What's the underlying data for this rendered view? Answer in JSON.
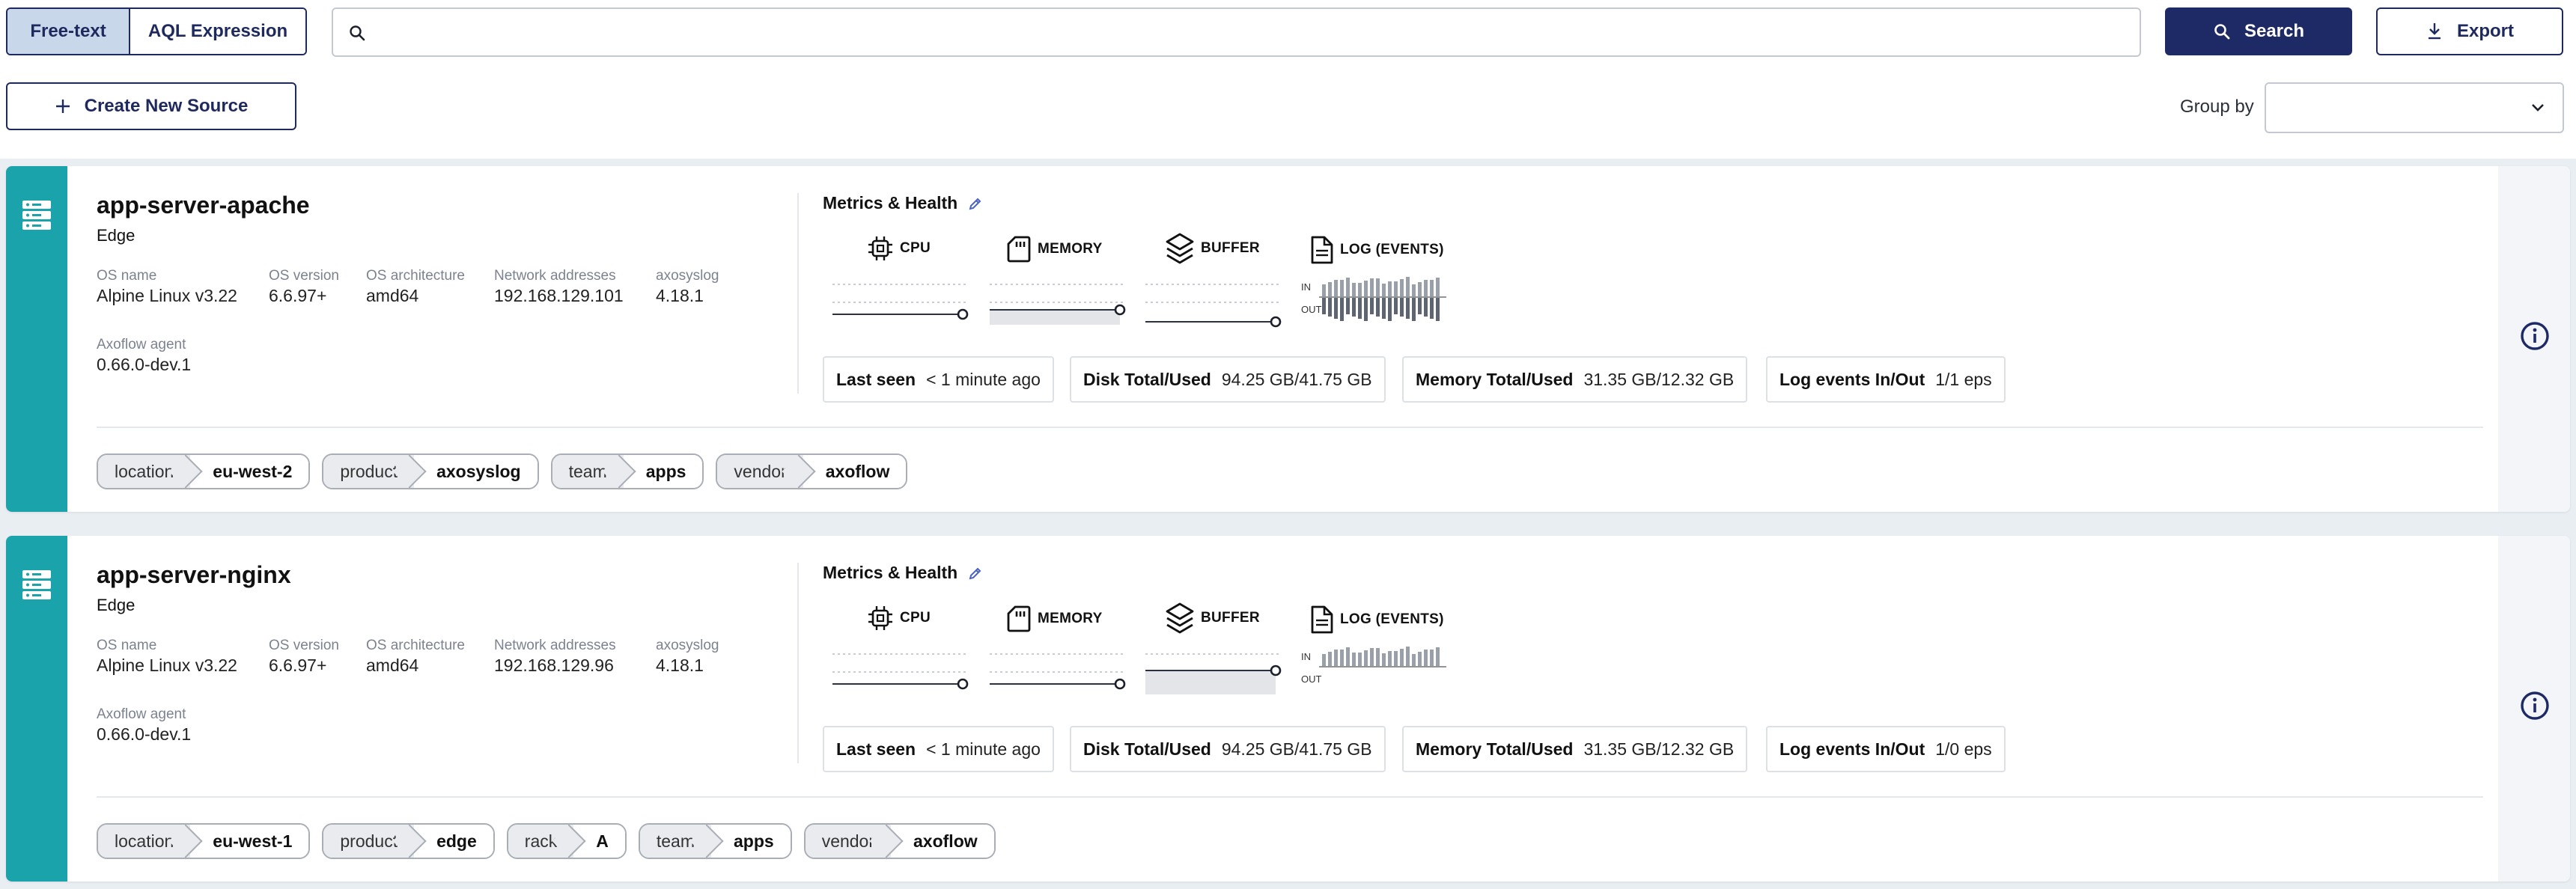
{
  "toolbar": {
    "mode_freetext": "Free-text",
    "mode_aql": "AQL Expression",
    "search_placeholder": "",
    "search_label": "Search",
    "export_label": "Export",
    "create_label": "Create New Source",
    "groupby_label": "Group by",
    "groupby_value": ""
  },
  "metrics_labels": {
    "title": "Metrics & Health",
    "cpu": "CPU",
    "memory": "MEMORY",
    "buffer": "BUFFER",
    "log": "LOG (EVENTS)",
    "in": "IN",
    "out": "OUT"
  },
  "field_labels": {
    "os_name": "OS name",
    "os_version": "OS version",
    "os_arch": "OS architecture",
    "network": "Network addresses",
    "axosyslog": "axosyslog",
    "agent": "Axoflow agent"
  },
  "stat_labels": {
    "last_seen": "Last seen",
    "disk": "Disk Total/Used",
    "memory": "Memory Total/Used",
    "log_events": "Log events In/Out"
  },
  "sources": [
    {
      "name": "app-server-apache",
      "kind": "Edge",
      "os_name": "Alpine Linux v3.22",
      "os_version": "6.6.97+",
      "os_arch": "amd64",
      "network": "192.168.129.101",
      "axosyslog": "4.18.1",
      "agent": "0.66.0-dev.1",
      "last_seen": "< 1 minute ago",
      "disk": "94.25 GB/41.75 GB",
      "memory": "31.35 GB/12.32 GB",
      "log_events": "1/1 eps",
      "tags": [
        {
          "k": "location",
          "v": "eu-west-2"
        },
        {
          "k": "product",
          "v": "axosyslog"
        },
        {
          "k": "team",
          "v": "apps"
        },
        {
          "k": "vendor",
          "v": "axoflow"
        }
      ]
    },
    {
      "name": "app-server-nginx",
      "kind": "Edge",
      "os_name": "Alpine Linux v3.22",
      "os_version": "6.6.97+",
      "os_arch": "amd64",
      "network": "192.168.129.96",
      "axosyslog": "4.18.1",
      "agent": "0.66.0-dev.1",
      "last_seen": "< 1 minute ago",
      "disk": "94.25 GB/41.75 GB",
      "memory": "31.35 GB/12.32 GB",
      "log_events": "1/0 eps",
      "tags": [
        {
          "k": "location",
          "v": "eu-west-1"
        },
        {
          "k": "product",
          "v": "edge"
        },
        {
          "k": "rack",
          "v": "A"
        },
        {
          "k": "team",
          "v": "apps"
        },
        {
          "k": "vendor",
          "v": "axoflow"
        }
      ]
    }
  ],
  "colors": {
    "primary": "#1e2a66",
    "teal": "#1aa3ab",
    "segment_active": "#c9d7ea"
  }
}
